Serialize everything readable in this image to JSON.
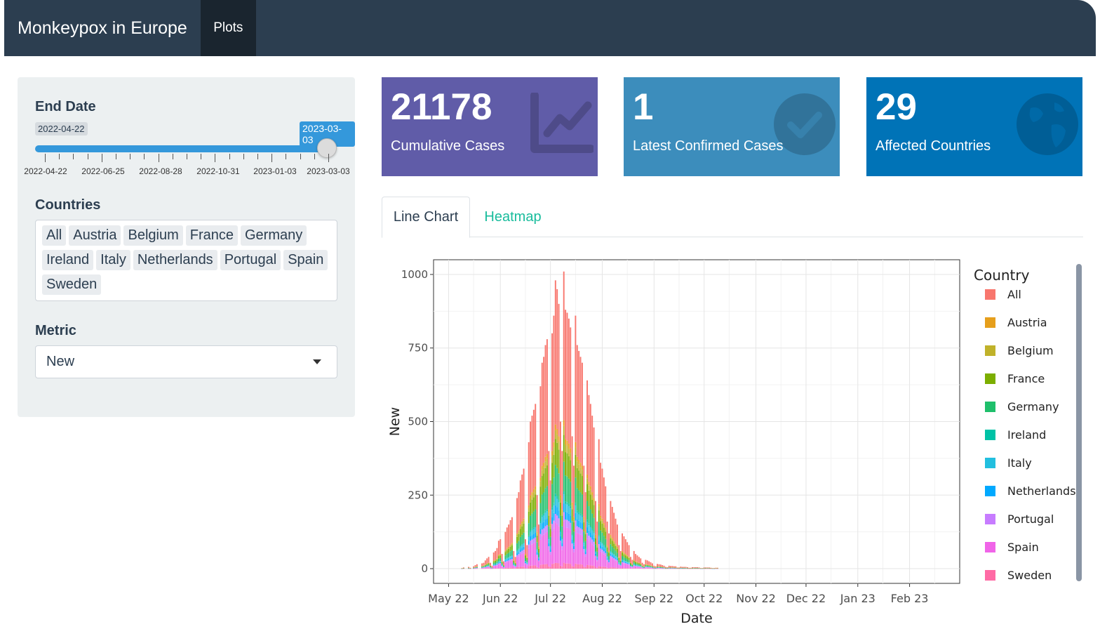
{
  "navbar": {
    "title": "Monkeypox in Europe",
    "tab": "Plots"
  },
  "sidebar": {
    "end_date": {
      "label": "End Date",
      "min_label": "2022-04-22",
      "value": "2023-03-03",
      "ticks": [
        "2022-04-22",
        "2022-06-25",
        "2022-08-28",
        "2022-10-31",
        "2023-01-03",
        "2023-03-03"
      ]
    },
    "countries": {
      "label": "Countries",
      "selected": [
        "All",
        "Austria",
        "Belgium",
        "France",
        "Germany",
        "Ireland",
        "Italy",
        "Netherlands",
        "Portugal",
        "Spain",
        "Sweden"
      ]
    },
    "metric": {
      "label": "Metric",
      "value": "New"
    }
  },
  "value_boxes": [
    {
      "value": "21178",
      "subtitle": "Cumulative Cases",
      "color": "#605ca8",
      "icon": "chart-line-icon"
    },
    {
      "value": "1",
      "subtitle": "Latest Confirmed Cases",
      "color": "#3c8dbc",
      "icon": "check-circle-icon"
    },
    {
      "value": "29",
      "subtitle": "Affected Countries",
      "color": "#0073b7",
      "icon": "globe-icon"
    }
  ],
  "tabs": [
    {
      "label": "Line Chart",
      "active": true
    },
    {
      "label": "Heatmap",
      "active": false
    }
  ],
  "chart_data": {
    "type": "bar",
    "stacked": true,
    "xlabel": "Date",
    "ylabel": "New",
    "x_ticks": [
      "May 22",
      "Jun 22",
      "Jul 22",
      "Aug 22",
      "Sep 22",
      "Oct 22",
      "Nov 22",
      "Dec 22",
      "Jan 23",
      "Feb 23"
    ],
    "y_ticks": [
      0,
      250,
      500,
      750,
      1000
    ],
    "ylim": [
      -50,
      1050
    ],
    "x_range": [
      "2022-04-22",
      "2023-03-03"
    ],
    "grid": true,
    "legend": {
      "title": "Country",
      "placement": "right",
      "entries": [
        {
          "name": "All",
          "color": "#f8766d"
        },
        {
          "name": "Austria",
          "color": "#e69f1c"
        },
        {
          "name": "Belgium",
          "color": "#c0b22a"
        },
        {
          "name": "France",
          "color": "#7cae00"
        },
        {
          "name": "Germany",
          "color": "#1fbf6b"
        },
        {
          "name": "Ireland",
          "color": "#00c2a6"
        },
        {
          "name": "Italy",
          "color": "#22bfdf"
        },
        {
          "name": "Netherlands",
          "color": "#00a9ff"
        },
        {
          "name": "Portugal",
          "color": "#c77cff"
        },
        {
          "name": "Spain",
          "color": "#f064e8"
        },
        {
          "name": "Sweden",
          "color": "#ff6aa5"
        }
      ]
    },
    "series_shares": {
      "All": 0.5,
      "Austria": 0.02,
      "Belgium": 0.03,
      "France": 0.09,
      "Germany": 0.1,
      "Ireland": 0.01,
      "Italy": 0.03,
      "Netherlands": 0.03,
      "Portugal": 0.03,
      "Spain": 0.14,
      "Sweden": 0.02
    },
    "daily_totals_by_week": [
      {
        "week_of": "2022-05-09",
        "values": [
          2,
          4,
          0,
          0,
          6,
          3,
          0
        ]
      },
      {
        "week_of": "2022-05-16",
        "values": [
          8,
          12,
          15,
          0,
          0,
          18,
          20
        ]
      },
      {
        "week_of": "2022-05-23",
        "values": [
          28,
          35,
          40,
          20,
          10,
          55,
          60
        ]
      },
      {
        "week_of": "2022-05-30",
        "values": [
          70,
          95,
          100,
          50,
          25,
          125,
          140
        ]
      },
      {
        "week_of": "2022-06-06",
        "values": [
          150,
          165,
          175,
          60,
          40,
          240,
          260
        ]
      },
      {
        "week_of": "2022-06-13",
        "values": [
          300,
          320,
          340,
          100,
          80,
          430,
          500
        ]
      },
      {
        "week_of": "2022-06-20",
        "values": [
          520,
          540,
          560,
          250,
          150,
          620,
          700
        ]
      },
      {
        "week_of": "2022-06-27",
        "values": [
          720,
          760,
          780,
          400,
          300,
          800,
          860
        ]
      },
      {
        "week_of": "2022-07-04",
        "values": [
          980,
          950,
          900,
          500,
          400,
          1010,
          880
        ]
      },
      {
        "week_of": "2022-07-11",
        "values": [
          870,
          850,
          820,
          450,
          350,
          860,
          760
        ]
      },
      {
        "week_of": "2022-07-18",
        "values": [
          740,
          720,
          700,
          350,
          260,
          640,
          590
        ]
      },
      {
        "week_of": "2022-07-25",
        "values": [
          560,
          520,
          480,
          230,
          160,
          440,
          360
        ]
      },
      {
        "week_of": "2022-08-01",
        "values": [
          340,
          310,
          280,
          160,
          120,
          230,
          210
        ]
      },
      {
        "week_of": "2022-08-08",
        "values": [
          190,
          170,
          150,
          80,
          60,
          120,
          110
        ]
      },
      {
        "week_of": "2022-08-15",
        "values": [
          100,
          90,
          80,
          40,
          30,
          60,
          50
        ]
      },
      {
        "week_of": "2022-08-22",
        "values": [
          45,
          40,
          35,
          20,
          15,
          30,
          28
        ]
      },
      {
        "week_of": "2022-08-29",
        "values": [
          25,
          22,
          18,
          10,
          8,
          16,
          15
        ]
      },
      {
        "week_of": "2022-09-05",
        "values": [
          14,
          12,
          10,
          6,
          5,
          10,
          9
        ]
      },
      {
        "week_of": "2022-09-12",
        "values": [
          9,
          8,
          8,
          4,
          4,
          7,
          6
        ]
      },
      {
        "week_of": "2022-09-19",
        "values": [
          6,
          6,
          5,
          3,
          3,
          5,
          5
        ]
      },
      {
        "week_of": "2022-09-26",
        "values": [
          5,
          5,
          4,
          2,
          2,
          4,
          4
        ]
      },
      {
        "week_of": "2022-10-03",
        "values": [
          4,
          4,
          3,
          2,
          2,
          3,
          3
        ]
      }
    ]
  }
}
